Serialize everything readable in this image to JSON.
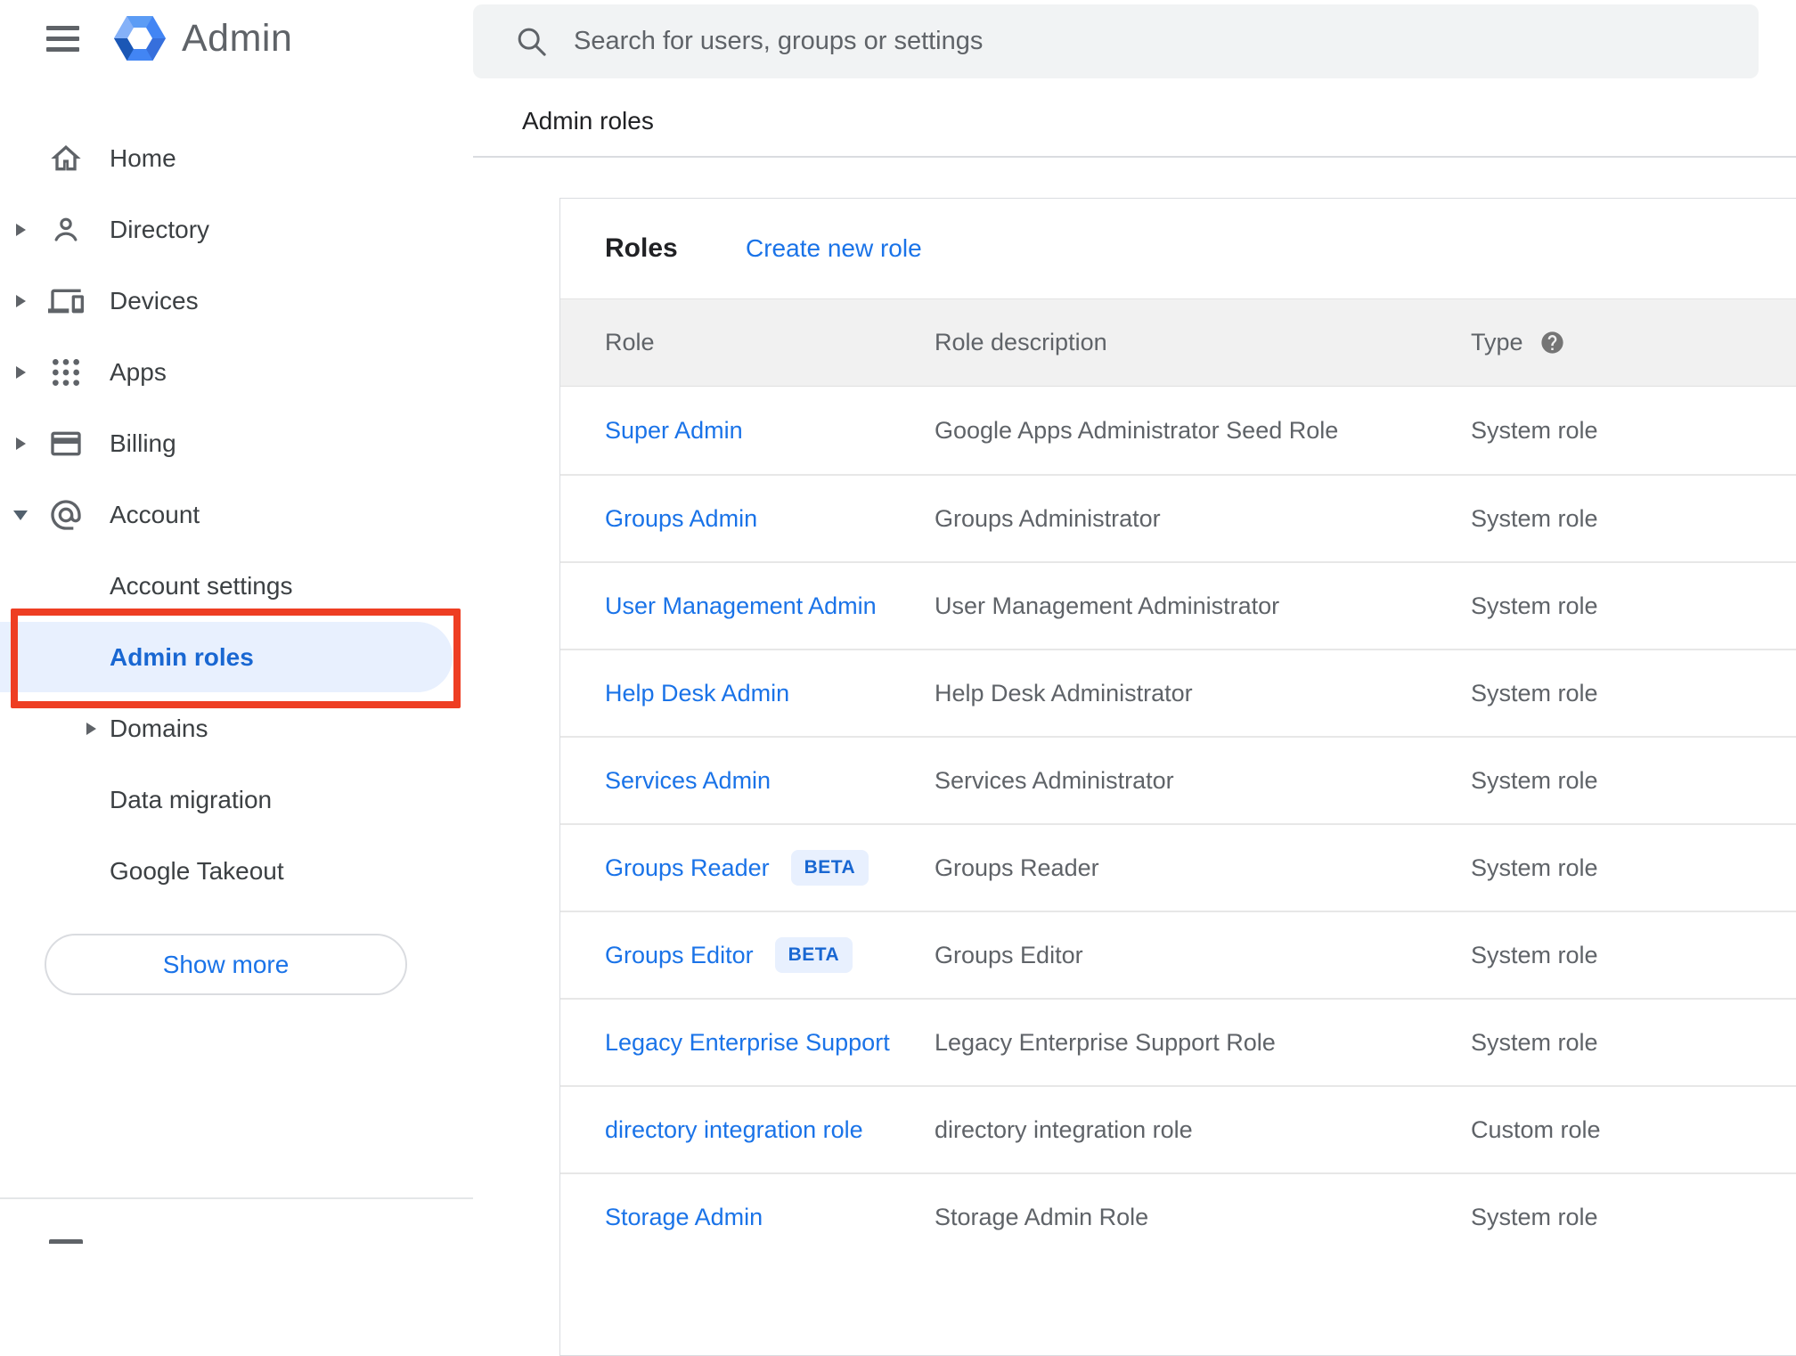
{
  "header": {
    "app_title": "Admin",
    "search": {
      "placeholder": "Search for users, groups or settings"
    }
  },
  "breadcrumb": "Admin roles",
  "sidebar": {
    "items": [
      {
        "label": "Home",
        "icon": "home-icon",
        "expandable": false
      },
      {
        "label": "Directory",
        "icon": "person-icon",
        "expandable": true
      },
      {
        "label": "Devices",
        "icon": "devices-icon",
        "expandable": true
      },
      {
        "label": "Apps",
        "icon": "apps-grid-icon",
        "expandable": true
      },
      {
        "label": "Billing",
        "icon": "credit-card-icon",
        "expandable": true
      },
      {
        "label": "Account",
        "icon": "at-sign-icon",
        "expandable": true,
        "expanded": true
      }
    ],
    "account_children": [
      {
        "label": "Account settings"
      },
      {
        "label": "Admin roles",
        "selected": true,
        "annotated": true
      },
      {
        "label": "Domains",
        "expandable": true
      },
      {
        "label": "Data migration"
      },
      {
        "label": "Google Takeout"
      }
    ],
    "show_more_label": "Show more"
  },
  "main": {
    "card_title": "Roles",
    "create_link": "Create new role",
    "table": {
      "columns": [
        "Role",
        "Role description",
        "Type"
      ],
      "type_help_icon": "help-icon",
      "beta_label": "BETA",
      "rows": [
        {
          "role": "Super Admin",
          "beta": false,
          "description": "Google Apps Administrator Seed Role",
          "type": "System role"
        },
        {
          "role": "Groups Admin",
          "beta": false,
          "description": "Groups Administrator",
          "type": "System role"
        },
        {
          "role": "User Management Admin",
          "beta": false,
          "description": "User Management Administrator",
          "type": "System role"
        },
        {
          "role": "Help Desk Admin",
          "beta": false,
          "description": "Help Desk Administrator",
          "type": "System role"
        },
        {
          "role": "Services Admin",
          "beta": false,
          "description": "Services Administrator",
          "type": "System role"
        },
        {
          "role": "Groups Reader",
          "beta": true,
          "description": "Groups Reader",
          "type": "System role"
        },
        {
          "role": "Groups Editor",
          "beta": true,
          "description": "Groups Editor",
          "type": "System role"
        },
        {
          "role": "Legacy Enterprise Support",
          "beta": false,
          "description": "Legacy Enterprise Support Role",
          "type": "System role"
        },
        {
          "role": "directory integration role",
          "beta": false,
          "description": "directory integration role",
          "type": "Custom role"
        },
        {
          "role": "Storage Admin",
          "beta": false,
          "description": "Storage Admin Role",
          "type": "System role"
        }
      ]
    }
  },
  "colors": {
    "link_blue": "#1a73e8",
    "selected_blue": "#1967d2",
    "selected_bg": "#e8f0fe",
    "annotation_red": "#ee3e23",
    "table_header_bg": "#f1f1f1",
    "icon_gray": "#5f6368",
    "logo_blue": "#4285f4"
  }
}
